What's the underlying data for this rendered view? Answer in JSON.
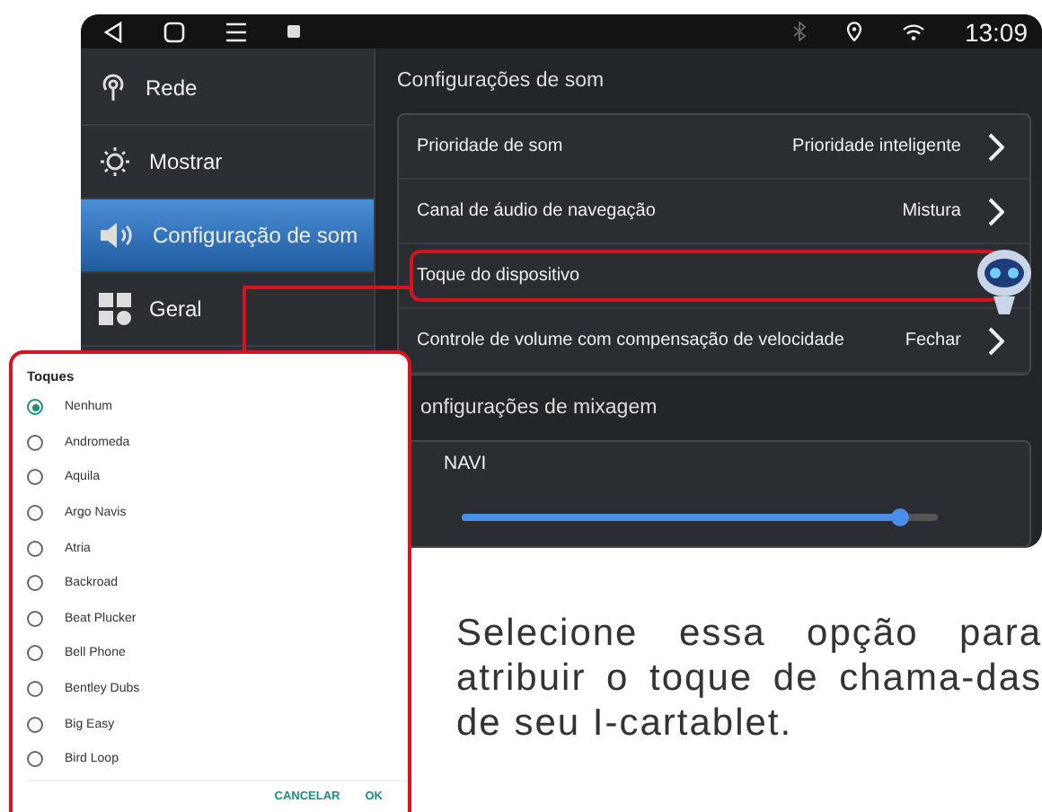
{
  "status_bar": {
    "time": "13:09"
  },
  "sidebar": {
    "items": [
      {
        "label": "Rede",
        "selected": false
      },
      {
        "label": "Mostrar",
        "selected": false
      },
      {
        "label": "Configuração de som",
        "selected": true
      },
      {
        "label": "Geral",
        "selected": false
      }
    ]
  },
  "sound_section": {
    "title": "Configurações de som",
    "rows": [
      {
        "label": "Prioridade de som",
        "value": "Prioridade inteligente",
        "highlighted": false
      },
      {
        "label": "Canal de áudio de navegação",
        "value": "Mistura",
        "highlighted": false
      },
      {
        "label": "Toque do dispositivo",
        "highlighted": true
      },
      {
        "label": "Controle de volume com compensação de velocidade",
        "value": "Fechar",
        "highlighted": false
      }
    ]
  },
  "mix_section": {
    "title": "onfigurações de mixagem",
    "slider": {
      "label": "NAVI",
      "level": 0.92
    }
  },
  "ringtone_dialog": {
    "title": "Toques",
    "options": [
      {
        "label": "Nenhum",
        "selected": true
      },
      {
        "label": "Andromeda",
        "selected": false
      },
      {
        "label": "Aquila",
        "selected": false
      },
      {
        "label": "Argo Navis",
        "selected": false
      },
      {
        "label": "Atria",
        "selected": false
      },
      {
        "label": "Backroad",
        "selected": false
      },
      {
        "label": "Beat Plucker",
        "selected": false
      },
      {
        "label": "Bell Phone",
        "selected": false
      },
      {
        "label": "Bentley Dubs",
        "selected": false
      },
      {
        "label": "Big Easy",
        "selected": false
      },
      {
        "label": "Bird Loop",
        "selected": false
      }
    ],
    "buttons": [
      "CANCELAR",
      "OK"
    ]
  },
  "caption": "Selecione essa opção para atribuir o toque de chama-das de seu I-cartablet."
}
